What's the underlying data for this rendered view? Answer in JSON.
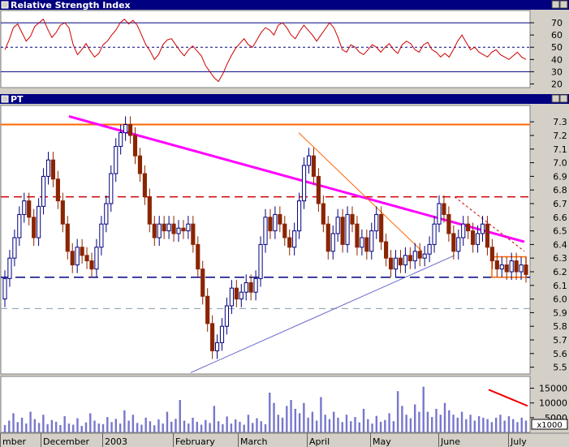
{
  "panels": {
    "rsi": {
      "title": "Relative Strength Index",
      "ticks": [
        20,
        30,
        40,
        50,
        60,
        70
      ],
      "ylim": [
        17,
        80
      ]
    },
    "price": {
      "title": "PT",
      "ticks": [
        5.5,
        5.6,
        5.7,
        5.8,
        5.9,
        6.0,
        6.1,
        6.2,
        6.3,
        6.4,
        6.5,
        6.6,
        6.7,
        6.8,
        6.9,
        7.0,
        7.1,
        7.2,
        7.3
      ],
      "ylim": [
        5.45,
        7.42
      ]
    },
    "volume": {
      "ticks": [
        "15000",
        "10000",
        "5000"
      ],
      "tick_values": [
        15000,
        10000,
        5000
      ],
      "unit": "x1000",
      "ylim": [
        0,
        19000
      ]
    }
  },
  "x_axis": {
    "labels": [
      "mber",
      "December",
      "2003",
      "February",
      "March",
      "April",
      "May",
      "June",
      "July"
    ]
  },
  "colors": {
    "background": "#d4d0c8",
    "plot_bg": "#ffffff",
    "title_bar": "#000080",
    "rsi_line": "#cc0000",
    "up_candle": "#000080",
    "down_candle": "#8b2500",
    "resistance_line": "#ff6600",
    "downtrend_line": "#ff00ff",
    "dashed_red": "#cc0000",
    "dashed_blue": "#000080",
    "uptrend_line": "#6666cc",
    "volume_bar": "#7777cc",
    "volume_trend": "#ee0000"
  },
  "chart_data": {
    "type": "candlestick",
    "rsi_reference_lines": [
      70,
      50,
      30
    ],
    "rsi": [
      48,
      56,
      66,
      69,
      62,
      55,
      59,
      67,
      70,
      73,
      65,
      58,
      62,
      68,
      70,
      66,
      52,
      44,
      48,
      53,
      47,
      42,
      45,
      52,
      55,
      60,
      64,
      70,
      73,
      69,
      72,
      68,
      60,
      52,
      47,
      40,
      44,
      52,
      56,
      57,
      52,
      47,
      43,
      48,
      51,
      47,
      43,
      35,
      30,
      25,
      22,
      28,
      36,
      43,
      49,
      53,
      57,
      52,
      50,
      56,
      62,
      66,
      64,
      60,
      68,
      70,
      66,
      60,
      57,
      63,
      68,
      64,
      60,
      55,
      60,
      65,
      70,
      66,
      58,
      48,
      46,
      52,
      50,
      46,
      44,
      48,
      52,
      50,
      46,
      50,
      53,
      48,
      45,
      52,
      55,
      53,
      48,
      46,
      52,
      54,
      48,
      46,
      42,
      45,
      42,
      48,
      55,
      60,
      54,
      48,
      50,
      46,
      44,
      42,
      46,
      48,
      44,
      42,
      40,
      43,
      46,
      42,
      40
    ],
    "price": [
      {
        "o": 6.0,
        "c": 6.15
      },
      {
        "o": 6.15,
        "c": 6.3
      },
      {
        "o": 6.3,
        "c": 6.45
      },
      {
        "o": 6.45,
        "c": 6.62
      },
      {
        "o": 6.62,
        "c": 6.72
      },
      {
        "o": 6.72,
        "c": 6.6
      },
      {
        "o": 6.6,
        "c": 6.45
      },
      {
        "o": 6.45,
        "c": 6.68
      },
      {
        "o": 6.68,
        "c": 6.9
      },
      {
        "o": 6.9,
        "c": 7.02
      },
      {
        "o": 7.02,
        "c": 6.88
      },
      {
        "o": 6.88,
        "c": 6.72
      },
      {
        "o": 6.72,
        "c": 6.55
      },
      {
        "o": 6.55,
        "c": 6.35
      },
      {
        "o": 6.35,
        "c": 6.25
      },
      {
        "o": 6.25,
        "c": 6.38
      },
      {
        "o": 6.38,
        "c": 6.32
      },
      {
        "o": 6.32,
        "c": 6.28
      },
      {
        "o": 6.28,
        "c": 6.22
      },
      {
        "o": 6.22,
        "c": 6.38
      },
      {
        "o": 6.38,
        "c": 6.55
      },
      {
        "o": 6.55,
        "c": 6.7
      },
      {
        "o": 6.7,
        "c": 6.92
      },
      {
        "o": 6.92,
        "c": 7.12
      },
      {
        "o": 7.12,
        "c": 7.22
      },
      {
        "o": 7.22,
        "c": 7.28
      },
      {
        "o": 7.28,
        "c": 7.2
      },
      {
        "o": 7.2,
        "c": 7.05
      },
      {
        "o": 7.05,
        "c": 6.92
      },
      {
        "o": 6.92,
        "c": 6.75
      },
      {
        "o": 6.75,
        "c": 6.55
      },
      {
        "o": 6.55,
        "c": 6.45
      },
      {
        "o": 6.45,
        "c": 6.55
      },
      {
        "o": 6.55,
        "c": 6.5
      },
      {
        "o": 6.5,
        "c": 6.55
      },
      {
        "o": 6.55,
        "c": 6.48
      },
      {
        "o": 6.48,
        "c": 6.52
      },
      {
        "o": 6.52,
        "c": 6.5
      },
      {
        "o": 6.5,
        "c": 6.55
      },
      {
        "o": 6.55,
        "c": 6.4
      },
      {
        "o": 6.4,
        "c": 6.22
      },
      {
        "o": 6.22,
        "c": 6.02
      },
      {
        "o": 6.02,
        "c": 5.82
      },
      {
        "o": 5.82,
        "c": 5.62
      },
      {
        "o": 5.62,
        "c": 5.68
      },
      {
        "o": 5.68,
        "c": 5.8
      },
      {
        "o": 5.8,
        "c": 5.95
      },
      {
        "o": 5.95,
        "c": 6.08
      },
      {
        "o": 6.08,
        "c": 6.0
      },
      {
        "o": 6.0,
        "c": 6.05
      },
      {
        "o": 6.05,
        "c": 6.12
      },
      {
        "o": 6.12,
        "c": 6.05
      },
      {
        "o": 6.05,
        "c": 6.15
      },
      {
        "o": 6.15,
        "c": 6.4
      },
      {
        "o": 6.4,
        "c": 6.6
      },
      {
        "o": 6.6,
        "c": 6.5
      },
      {
        "o": 6.5,
        "c": 6.62
      },
      {
        "o": 6.62,
        "c": 6.55
      },
      {
        "o": 6.55,
        "c": 6.45
      },
      {
        "o": 6.45,
        "c": 6.38
      },
      {
        "o": 6.38,
        "c": 6.5
      },
      {
        "o": 6.5,
        "c": 6.72
      },
      {
        "o": 6.72,
        "c": 6.98
      },
      {
        "o": 6.98,
        "c": 7.05
      },
      {
        "o": 7.05,
        "c": 6.9
      },
      {
        "o": 6.9,
        "c": 6.7
      },
      {
        "o": 6.7,
        "c": 6.55
      },
      {
        "o": 6.55,
        "c": 6.35
      },
      {
        "o": 6.35,
        "c": 6.48
      },
      {
        "o": 6.48,
        "c": 6.6
      },
      {
        "o": 6.6,
        "c": 6.4
      },
      {
        "o": 6.4,
        "c": 6.62
      },
      {
        "o": 6.62,
        "c": 6.55
      },
      {
        "o": 6.55,
        "c": 6.38
      },
      {
        "o": 6.38,
        "c": 6.45
      },
      {
        "o": 6.45,
        "c": 6.35
      },
      {
        "o": 6.35,
        "c": 6.5
      },
      {
        "o": 6.5,
        "c": 6.62
      },
      {
        "o": 6.62,
        "c": 6.42
      },
      {
        "o": 6.42,
        "c": 6.3
      },
      {
        "o": 6.3,
        "c": 6.22
      },
      {
        "o": 6.22,
        "c": 6.3
      },
      {
        "o": 6.3,
        "c": 6.25
      },
      {
        "o": 6.25,
        "c": 6.32
      },
      {
        "o": 6.32,
        "c": 6.28
      },
      {
        "o": 6.28,
        "c": 6.35
      },
      {
        "o": 6.35,
        "c": 6.3
      },
      {
        "o": 6.3,
        "c": 6.33
      },
      {
        "o": 6.33,
        "c": 6.4
      },
      {
        "o": 6.4,
        "c": 6.55
      },
      {
        "o": 6.55,
        "c": 6.7
      },
      {
        "o": 6.7,
        "c": 6.62
      },
      {
        "o": 6.62,
        "c": 6.48
      },
      {
        "o": 6.48,
        "c": 6.35
      },
      {
        "o": 6.35,
        "c": 6.45
      },
      {
        "o": 6.45,
        "c": 6.55
      },
      {
        "o": 6.55,
        "c": 6.5
      },
      {
        "o": 6.5,
        "c": 6.4
      },
      {
        "o": 6.4,
        "c": 6.48
      },
      {
        "o": 6.48,
        "c": 6.55
      },
      {
        "o": 6.55,
        "c": 6.38
      },
      {
        "o": 6.38,
        "c": 6.28
      },
      {
        "o": 6.28,
        "c": 6.22
      },
      {
        "o": 6.22,
        "c": 6.25
      },
      {
        "o": 6.25,
        "c": 6.2
      },
      {
        "o": 6.2,
        "c": 6.28
      },
      {
        "o": 6.28,
        "c": 6.2
      },
      {
        "o": 6.2,
        "c": 6.25
      },
      {
        "o": 6.25,
        "c": 6.18
      }
    ],
    "volume": [
      2500,
      4000,
      6500,
      3500,
      5000,
      3000,
      7000,
      4500,
      3200,
      6000,
      2800,
      4200,
      3600,
      2500,
      5500,
      3000,
      2600,
      4800,
      2200,
      3400,
      6500,
      4000,
      3000,
      2800,
      5200,
      3500,
      4600,
      3000,
      7500,
      4000,
      6000,
      3200,
      2600,
      5000,
      3800,
      2400,
      4400,
      3000,
      7000,
      3600,
      4600,
      11000,
      4000,
      3000,
      5000,
      3600,
      2600,
      4200,
      3200,
      9000,
      3800,
      2800,
      5400,
      3000,
      4400,
      3600,
      2600,
      6000,
      3200,
      4800,
      3800,
      2800,
      13500,
      10000,
      6000,
      5000,
      9000,
      11000,
      8000,
      6500,
      10000,
      5000,
      7000,
      4000,
      12000,
      6000,
      4500,
      7000,
      5000,
      3500,
      6000,
      3800,
      5200,
      3400,
      8000,
      4500,
      3000,
      5600,
      3600,
      4200,
      6500,
      3800,
      14000,
      9000,
      6000,
      4800,
      9500,
      7000,
      15500,
      7000,
      5200,
      8000,
      6000,
      10000,
      7500,
      6000,
      5000,
      7000,
      4500,
      6000,
      4000,
      5500,
      5000,
      4500,
      3500,
      5000,
      6000,
      4000,
      5500,
      4500,
      3500,
      5000,
      4000
    ]
  }
}
